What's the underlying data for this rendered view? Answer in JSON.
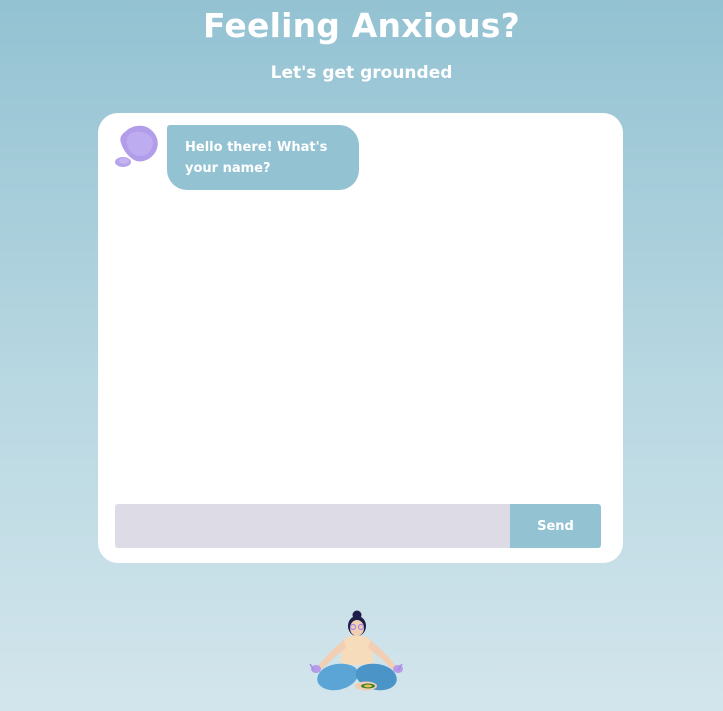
{
  "header": {
    "title": "Feeling Anxious?",
    "subtitle": "Let's get grounded"
  },
  "chat": {
    "messages": [
      {
        "sender": "bot",
        "text": "Hello there! What's your name?"
      }
    ],
    "input_value": "",
    "send_label": "Send"
  },
  "illustrations": {
    "avatar_icon": "purple-blob-avatar-icon",
    "footer_icon": "meditating-person-icon"
  },
  "colors": {
    "accent": "#93c2d2",
    "input_bg": "#dddbe5",
    "avatar": "#a48ce6",
    "card_bg": "#ffffff"
  }
}
